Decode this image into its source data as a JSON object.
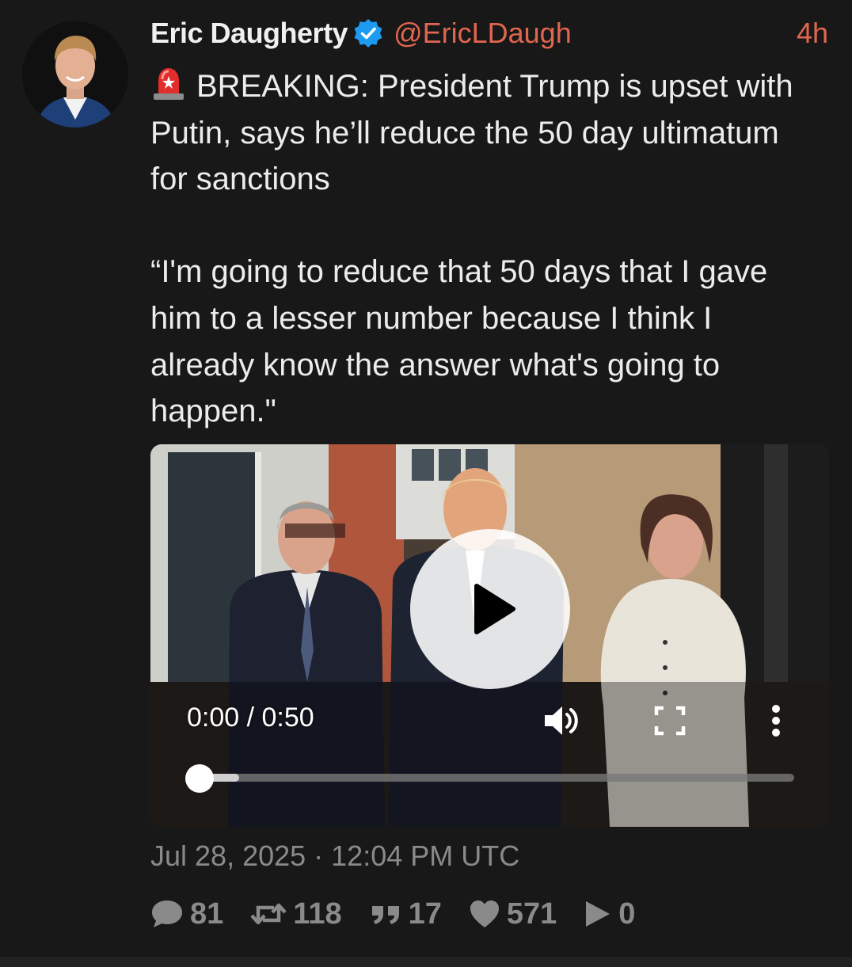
{
  "tweet": {
    "display_name": "Eric Daugherty",
    "handle": "@EricLDaugh",
    "time_ago": "4h",
    "verified_icon": "verified-badge-icon",
    "text_lines": [
      "BREAKING: President Trump is upset with Putin, says he’ll reduce the 50 day ultimatum for sanctions"
    ],
    "quote": "“I'm going to reduce that 50 days that I gave him to a lesser number because I think I already know the answer what's going to happen.\"",
    "lead_emoji": "police-light-icon",
    "date": "Jul 28, 2025 · 12:04 PM UTC"
  },
  "video": {
    "time_display": "0:00 / 0:50",
    "progress": 0,
    "buffered": 0.05
  },
  "stats": {
    "replies": "81",
    "retweets": "118",
    "quotes": "17",
    "likes": "571",
    "views": "0"
  },
  "colors": {
    "background": "#181818",
    "accent": "#e2664f",
    "verified": "#1d9bf0",
    "muted": "#8a8a8a"
  }
}
